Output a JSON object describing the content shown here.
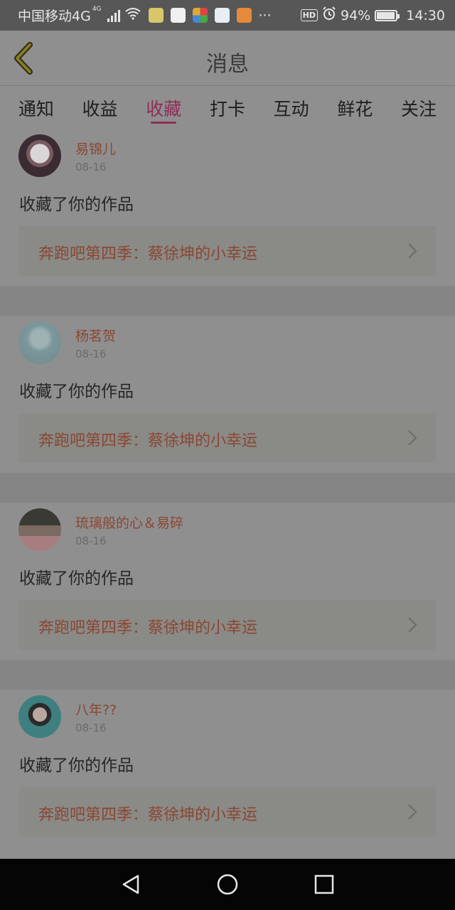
{
  "status_bar": {
    "carrier": "中国移动4G",
    "network_badge": "4G",
    "battery_percent": "94%",
    "time": "14:30",
    "hd_label": "HD",
    "more": "···",
    "app_icons": [
      "weather-icon",
      "baidu-icon",
      "colorful-app-icon",
      "blue-app-icon",
      "uc-browser-icon"
    ]
  },
  "header": {
    "title": "消息"
  },
  "tabs": [
    {
      "label": "通知",
      "active": false
    },
    {
      "label": "收益",
      "active": false
    },
    {
      "label": "收藏",
      "active": true
    },
    {
      "label": "打卡",
      "active": false
    },
    {
      "label": "互动",
      "active": false
    },
    {
      "label": "鲜花",
      "active": false
    },
    {
      "label": "关注",
      "active": false
    }
  ],
  "messages": [
    {
      "username": "易锦儿",
      "date": "08-16",
      "action": "收藏了你的作品",
      "work_title": "奔跑吧第四季：蔡徐坤的小幸运"
    },
    {
      "username": "杨茗贺",
      "date": "08-16",
      "action": "收藏了你的作品",
      "work_title": "奔跑吧第四季：蔡徐坤的小幸运"
    },
    {
      "username": "琉璃般的心＆易碎",
      "date": "08-16",
      "action": "收藏了你的作品",
      "work_title": "奔跑吧第四季：蔡徐坤的小幸运"
    },
    {
      "username": "八年??",
      "date": "08-16",
      "action": "收藏了你的作品",
      "work_title": "奔跑吧第四季：蔡徐坤的小幸运"
    }
  ],
  "colors": {
    "accent": "#8e2e57",
    "username": "#8a4732",
    "overlay_bg": "#8f8f8f"
  }
}
